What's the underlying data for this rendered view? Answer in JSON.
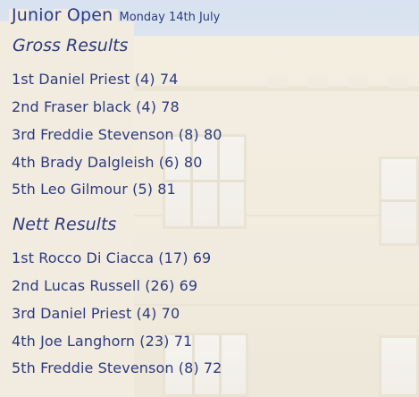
{
  "header": {
    "title": "Junior Open",
    "date": "Monday 14th July"
  },
  "gross": {
    "title": "Gross Results",
    "results": [
      "1st Daniel Priest (4) 74",
      "2nd Fraser black (4) 78",
      "3rd Freddie Stevenson (8) 80",
      "4th Brady Dalgleish (6) 80",
      "5th Leo Gilmour (5) 81"
    ]
  },
  "nett": {
    "title": "Nett Results",
    "results": [
      "1st Rocco Di Ciacca (17) 69",
      "2nd Lucas Russell (26) 69",
      "3rd Daniel Priest (4) 70",
      "4th Joe Langhorn (23) 71",
      "5th Freddie Stevenson (8) 72"
    ]
  },
  "colors": {
    "text": "#2e3a7e"
  }
}
